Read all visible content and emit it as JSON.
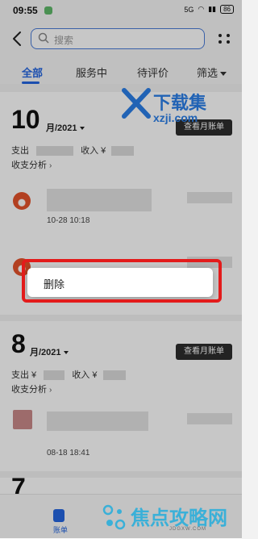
{
  "status": {
    "time": "09:55",
    "network": "5G",
    "battery": "86"
  },
  "search": {
    "placeholder": "搜索"
  },
  "tabs": [
    {
      "label": "全部"
    },
    {
      "label": "服务中"
    },
    {
      "label": "待评价"
    },
    {
      "label": "筛选"
    }
  ],
  "months": [
    {
      "month": "10",
      "year_month": "月/2021",
      "bill_button": "查看月账单",
      "expense_label": "支出",
      "income_label": "收入 ¥",
      "analysis_label": "收支分析",
      "transactions": [
        {
          "date": "10-28  10:18"
        }
      ]
    },
    {
      "month": "8",
      "year_month": "月/2021",
      "bill_button": "查看月账单",
      "expense_label": "支出 ¥",
      "income_label": "收入 ¥",
      "analysis_label": "收支分析",
      "transactions": [
        {
          "date": "08-18  18:41"
        }
      ]
    },
    {
      "month": "7"
    }
  ],
  "context_menu": {
    "delete_label": "删除"
  },
  "bottom_nav": {
    "label": "账单"
  },
  "watermarks": {
    "top_title": "下载集",
    "top_url": "xzji.com",
    "bottom_title": "焦点攻略网",
    "bottom_url": "JDGXW.COM"
  },
  "colors": {
    "accent": "#2466e0",
    "highlight": "#e31b1b"
  }
}
